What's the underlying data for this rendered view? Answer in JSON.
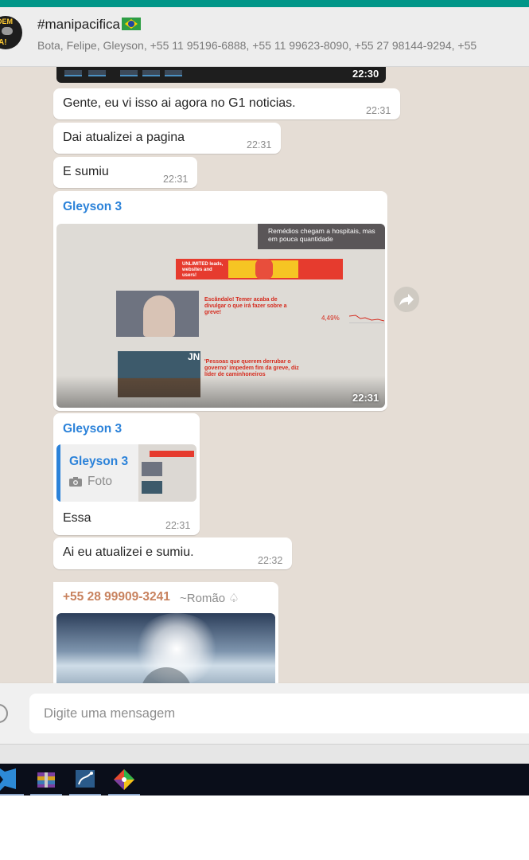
{
  "header": {
    "title": "#manipacifica",
    "participants": "Bota, Felipe, Gleyson, +55 11 95196-6888, +55 11 99623-8090, +55 27 98144-9294, +55",
    "avatar_text_top": "DEM",
    "avatar_text_bottom": "A!"
  },
  "messages": {
    "top_image": {
      "time": "22:30"
    },
    "m1": {
      "text": "Gente, eu vi isso ai agora no G1 noticias.",
      "time": "22:31"
    },
    "m2": {
      "text": "Dai atualizei a pagina",
      "time": "22:31"
    },
    "m3": {
      "text": "E sumiu",
      "time": "22:31"
    },
    "photo_msg": {
      "sender": "Gleyson 3",
      "time": "22:31",
      "photo": {
        "headline": "Remédios chegam a hospitais, mas em pouca quantidade",
        "ad": "UNLIMITED leads, websites and users!",
        "story1": "Escândalo! Temer acaba de divulgar o que irá fazer sobre a greve!",
        "jn": "JN",
        "story2": "'Pessoas que querem derrubar o governo' impedem fim da greve, diz líder de caminhoneiros",
        "figure": "4,49%"
      }
    },
    "reply_msg": {
      "sender": "Gleyson 3",
      "quoted_sender": "Gleyson 3",
      "quoted_type": "Foto",
      "text": "Essa",
      "time": "22:31"
    },
    "m4": {
      "text": "Ai eu atualizei e sumiu.",
      "time": "22:32"
    },
    "romao_msg": {
      "phone": "+55 28 99909-3241",
      "name": "~Romão ♤"
    }
  },
  "composer": {
    "placeholder": "Digite uma mensagem"
  },
  "icons": [
    "emoji-icon",
    "forward-icon",
    "camera-icon",
    "vscode-icon",
    "winrar-icon",
    "sql-icon",
    "git-icon"
  ],
  "colors": {
    "accent": "#009688",
    "chat_bg": "#e5ddd5",
    "sender_blue": "#2b82d9",
    "sender_orange": "#c8825e"
  }
}
